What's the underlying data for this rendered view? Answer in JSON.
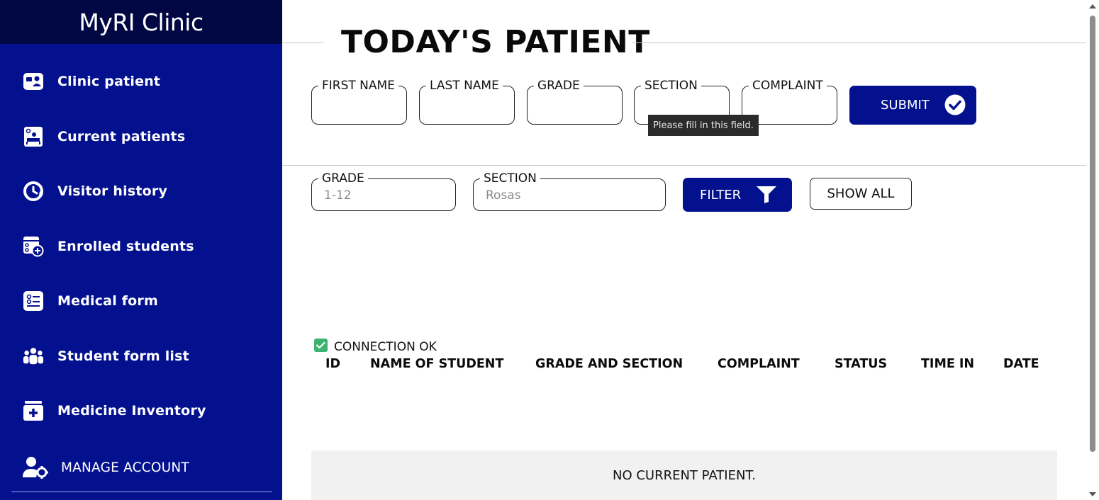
{
  "app": {
    "brand": "MyRI Clinic"
  },
  "sidebar": {
    "items": [
      {
        "label": "Clinic patient",
        "icon": "patient-card-icon"
      },
      {
        "label": "Current patients",
        "icon": "patient-bed-icon"
      },
      {
        "label": "Visitor history",
        "icon": "history-clock-icon"
      },
      {
        "label": "Enrolled students",
        "icon": "enroll-add-icon"
      },
      {
        "label": "Medical form",
        "icon": "form-list-icon"
      },
      {
        "label": "Student form list",
        "icon": "group-users-icon"
      },
      {
        "label": "Medicine Inventory",
        "icon": "medical-kit-icon"
      }
    ],
    "manage_account": {
      "label": "MANAGE ACCOUNT",
      "icon": "user-gear-icon"
    }
  },
  "main": {
    "title": "TODAY'S PATIENT",
    "form": {
      "fields": [
        {
          "legend": "FIRST NAME",
          "value": ""
        },
        {
          "legend": "LAST NAME",
          "value": ""
        },
        {
          "legend": "GRADE",
          "value": ""
        },
        {
          "legend": "SECTION",
          "value": ""
        },
        {
          "legend": "COMPLAINT",
          "value": ""
        }
      ],
      "submit_label": "SUBMIT",
      "submit_icon": "check-circle-icon",
      "tooltip": "Please fill in this field."
    },
    "filter": {
      "grade": {
        "legend": "GRADE",
        "placeholder": "1-12",
        "value": ""
      },
      "section": {
        "legend": "SECTION",
        "placeholder": "Rosas",
        "value": ""
      },
      "filter_label": "FILTER",
      "filter_icon": "funnel-icon",
      "show_all_label": "SHOW ALL"
    },
    "connection": {
      "status": "CONNECTION OK",
      "icon": "check-box-icon",
      "color": "#3cb371"
    },
    "table": {
      "columns": [
        "ID",
        "NAME OF STUDENT",
        "GRADE AND SECTION",
        "COMPLAINT",
        "STATUS",
        "TIME IN",
        "DATE"
      ],
      "empty_message": "NO CURRENT PATIENT."
    }
  },
  "colors": {
    "sidebar": "#04118f",
    "brand_bar": "#000742",
    "accent": "#04118f"
  }
}
